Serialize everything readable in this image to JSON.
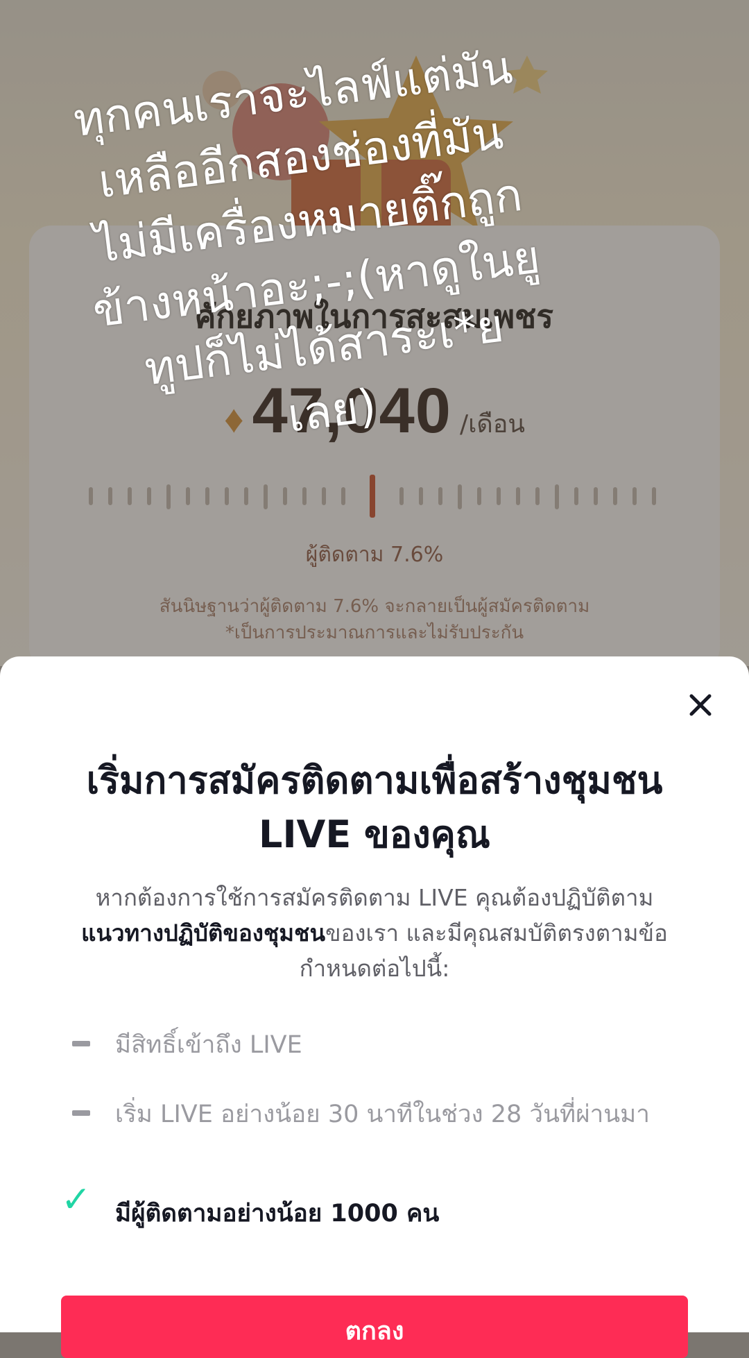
{
  "background": {
    "card_title": "ศักยภาพในการสะสมเพชร",
    "diamond_value": "47,040",
    "diamond_unit": "/เดือน",
    "follower_rate_label": "ผู้ติดตาม 7.6%",
    "assumption_line1": "สันนิษฐานว่าผู้ติดตาม 7.6% จะกลายเป็นผู้สมัครติดตาม",
    "assumption_line2": "*เป็นการประมาณการและไม่รับประกัน"
  },
  "overlay_caption": "ทุกคนเราจะไลฟ์แต่มัน\nเหลืออีกสองช่องที่มัน\nไม่มีเครื่องหมายติ๊กถูก\nข้างหน้าอะ;-;(หาดูในยู\nทูปก็ไม่ได้สาระเ*ย\nเลย)",
  "sheet": {
    "title": "เริ่มการสมัครติดตามเพื่อสร้างชุมชน LIVE ของคุณ",
    "desc_part1": "หากต้องการใช้การสมัครติดตาม LIVE คุณต้องปฏิบัติตาม",
    "desc_link": "แนวทางปฏิบัติของชุมชน",
    "desc_part2": "ของเรา และมีคุณสมบัติตรงตามข้อกำหนดต่อไปนี้:",
    "requirements": [
      {
        "text": "มีสิทธิ์เข้าถึง LIVE",
        "met": false
      },
      {
        "text": "เริ่ม LIVE อย่างน้อย 30 นาทีในช่วง 28 วันที่ผ่านมา",
        "met": false
      },
      {
        "text": "มีผู้ติดตามอย่างน้อย 1000 คน",
        "met": true
      }
    ],
    "cta_label": "ตกลง"
  },
  "colors": {
    "accent": "#fe2c55",
    "check": "#20d5a4",
    "text_primary": "#161823"
  }
}
